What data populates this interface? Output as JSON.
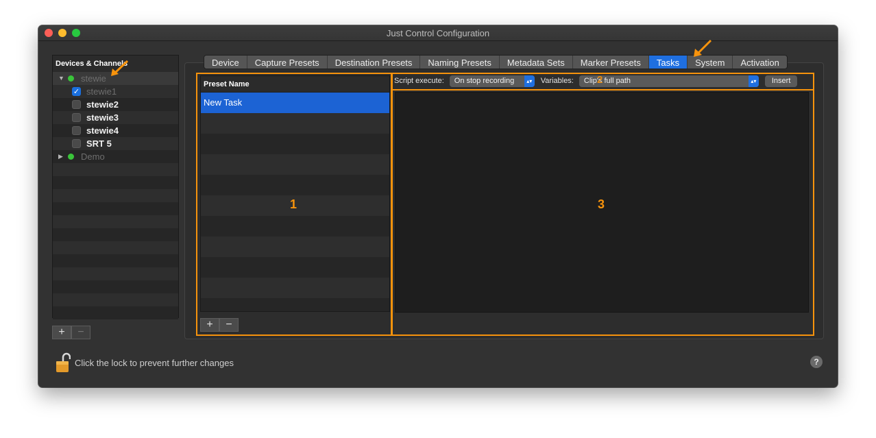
{
  "window": {
    "title": "Just Control Configuration"
  },
  "sidebar": {
    "header": "Devices & Channels",
    "devices": [
      {
        "label": "stewie",
        "status": "online",
        "expanded": true
      },
      {
        "label": "stewie1",
        "checked": true
      },
      {
        "label": "stewie2",
        "checked": false
      },
      {
        "label": "stewie3",
        "checked": false
      },
      {
        "label": "stewie4",
        "checked": false
      },
      {
        "label": "SRT 5",
        "checked": false
      },
      {
        "label": "Demo",
        "status": "online",
        "expanded": false
      }
    ],
    "add_label": "+",
    "remove_label": "−"
  },
  "tabs": [
    {
      "label": "Device"
    },
    {
      "label": "Capture Presets"
    },
    {
      "label": "Destination Presets"
    },
    {
      "label": "Naming Presets"
    },
    {
      "label": "Metadata Sets"
    },
    {
      "label": "Marker Presets"
    },
    {
      "label": "Tasks",
      "active": true
    },
    {
      "label": "System"
    },
    {
      "label": "Activation"
    }
  ],
  "presets": {
    "header": "Preset Name",
    "items": [
      "New Task"
    ],
    "add_label": "+",
    "remove_label": "−"
  },
  "script": {
    "execute_label": "Script execute:",
    "execute_value": "On stop recording",
    "variables_label": "Variables:",
    "variables_value": "Clip's full path",
    "insert_label": "Insert"
  },
  "annotations": {
    "one": "1",
    "two": "2",
    "three": "3"
  },
  "footer": {
    "lock_text": "Click the lock to prevent further changes",
    "help_label": "?"
  },
  "colors": {
    "accent": "#1f6fe0",
    "annotation": "#f7930c",
    "status_online": "#3ac43a"
  }
}
